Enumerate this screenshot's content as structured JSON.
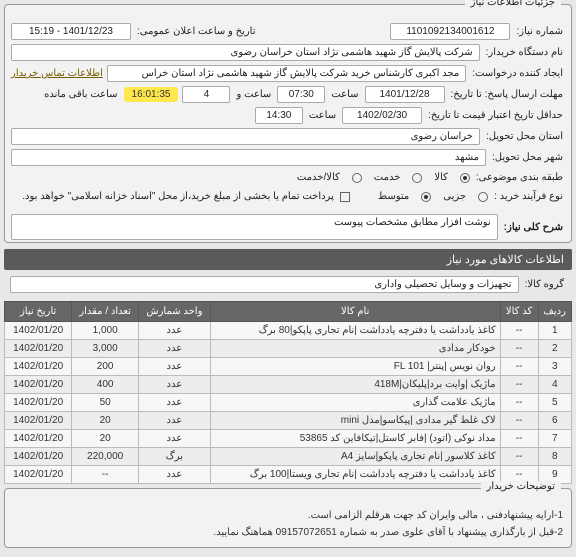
{
  "panels": {
    "details_title": "جزئیات اطلاعات نیاز",
    "items_info_title": "اطلاعات کالاهای مورد نیاز",
    "notes_title": "توضیحات خریدار"
  },
  "header": {
    "need_number_lbl": "شماره نیاز:",
    "need_number": "1101092134001612",
    "announce_date_lbl": "تاریخ و ساعت اعلان عمومی:",
    "announce_date": "1401/12/23 - 15:19",
    "buyer_org_lbl": "نام دستگاه خریدار:",
    "buyer_org": "شرکت پالایش گاز شهید هاشمی نژاد   استان خراسان رضوی",
    "requester_lbl": "ایجاد کننده درخواست:",
    "requester": "مجد اکبری کارشناس خرید شرکت پالایش گاز شهید هاشمی نژاد   استان خراس",
    "contact_link": "اطلاعات تماس خریدار",
    "deadline_lbl": "مهلت ارسال پاسخ: تا تاریخ:",
    "deadline_date": "1401/12/28",
    "deadline_time_lbl": "ساعت",
    "deadline_time": "07:30",
    "remaining_lbl": "ساعت و",
    "remaining_val": "4",
    "remaining_badge": "16:01:35",
    "remaining_suffix": "ساعت باقی مانده",
    "credit_lbl": "حداقل تاریخ اعتبار قیمت تا تاریخ:",
    "credit_date": "1402/02/30",
    "credit_time_lbl": "ساعت",
    "credit_time": "14:30",
    "province_lbl": "استان محل تحویل:",
    "province": "خراسان رضوی",
    "city_lbl": "شهر محل تحویل:",
    "city": "مشهد",
    "category_lbl": "طبقه بندی موضوعی:",
    "cat_goods": "کالا",
    "cat_service": "خدمت",
    "cat_goods_service": "کالا/خدمت",
    "purchase_type_lbl": "نوع فرآیند خرید :",
    "pt_small": "جزیی",
    "pt_medium": "متوسط",
    "pt_note": "پرداخت تمام یا بخشی از مبلغ خرید،از محل \"اسناد خزانه اسلامی\" خواهد بود.",
    "desc_lbl": "شرح کلی نیاز:",
    "desc_val": "نوشت افزار مطابق مشخصات پیوست",
    "group_lbl": "گروه کالا:",
    "group_val": "تجهیزات و وسایل تحصیلی واداری"
  },
  "table": {
    "headers": {
      "row": "ردیف",
      "code": "کد کالا",
      "name": "نام کالا",
      "unit": "واحد شمارش",
      "qty": "تعداد / مقدار",
      "date": "تاریخ نیاز"
    },
    "rows": [
      {
        "n": "1",
        "code": "--",
        "name": "کاغذ یادداشت یا دفترچه یادداشت |نام تجاری پاپکو|80 برگ",
        "unit": "عدد",
        "qty": "1,000",
        "date": "1402/01/20"
      },
      {
        "n": "2",
        "code": "--",
        "name": "خودکار مدادی",
        "unit": "عدد",
        "qty": "3,000",
        "date": "1402/01/20"
      },
      {
        "n": "3",
        "code": "--",
        "name": "روان نویس |پنتر| FL 101",
        "unit": "عدد",
        "qty": "200",
        "date": "1402/01/20"
      },
      {
        "n": "4",
        "code": "--",
        "name": "ماژیک |وایت برد|پلیکان|418M",
        "unit": "عدد",
        "qty": "400",
        "date": "1402/01/20"
      },
      {
        "n": "5",
        "code": "--",
        "name": "ماژیک علامت گذاری",
        "unit": "عدد",
        "qty": "50",
        "date": "1402/01/20"
      },
      {
        "n": "6",
        "code": "--",
        "name": "لاک غلط گیر مدادی |پیکاسو|مدل mini",
        "unit": "عدد",
        "qty": "20",
        "date": "1402/01/20"
      },
      {
        "n": "7",
        "code": "--",
        "name": "مداد نوکی (اتود) |فابر کاستل|تیکافاین کد 53865",
        "unit": "عدد",
        "qty": "20",
        "date": "1402/01/20"
      },
      {
        "n": "8",
        "code": "--",
        "name": "کاغذ کلاسور |نام تجاری پاپکو|سایز A4",
        "unit": "برگ",
        "qty": "220,000",
        "date": "1402/01/20"
      },
      {
        "n": "9",
        "code": "--",
        "name": "کاغذ یادداشت یا دفترچه یادداشت |نام تجاری ویستا|100 برگ",
        "unit": "عدد",
        "qty": "--",
        "date": "1402/01/20"
      }
    ]
  },
  "notes": {
    "l1": "1-ارایه پیشنهادفنی ، مالی وایران کد جهت هرقلم الزامی است.",
    "l2": "2-قبل از بارگذاری پیشنهاد با آقای علوی صدر به شماره 09157072651 هماهنگ نمایید."
  }
}
